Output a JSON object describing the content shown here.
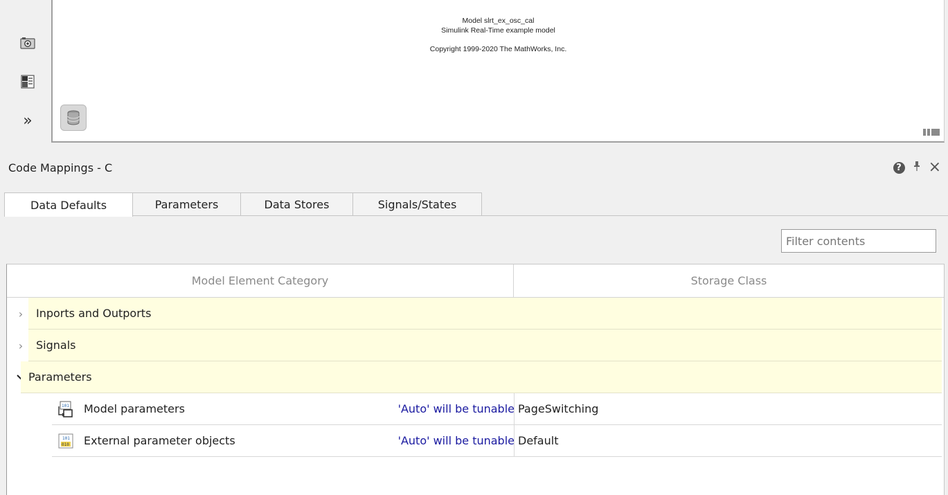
{
  "canvas": {
    "model_line": "Model slrt_ex_osc_cal",
    "subtitle_line": "Simulink Real-Time example model",
    "copyright_line": "Copyright 1999-2020 The MathWorks, Inc."
  },
  "left_toolbar": {
    "items": [
      {
        "icon": "camera-icon"
      },
      {
        "icon": "model-browser-icon"
      },
      {
        "icon": "expand-icon",
        "label": "»"
      }
    ]
  },
  "panel": {
    "title": "Code Mappings - C",
    "help_symbol": "?",
    "pin_symbol": "⫯",
    "close_symbol": "×"
  },
  "tabs": [
    {
      "label": "Data Defaults",
      "active": true
    },
    {
      "label": "Parameters",
      "active": false
    },
    {
      "label": "Data Stores",
      "active": false
    },
    {
      "label": "Signals/States",
      "active": false
    }
  ],
  "filter": {
    "placeholder": "Filter contents",
    "value": ""
  },
  "table": {
    "columns": [
      "Model Element Category",
      "Storage Class"
    ],
    "categories": [
      {
        "label": "Inports and Outports",
        "expanded": false
      },
      {
        "label": "Signals",
        "expanded": false
      },
      {
        "label": "Parameters",
        "expanded": true
      }
    ],
    "rows": [
      {
        "name": "Model parameters",
        "note": "'Auto' will be tunable",
        "storage_class": "PageSwitching",
        "icon": "model-parameter-icon"
      },
      {
        "name": "External parameter objects",
        "note": "'Auto' will be tunable",
        "storage_class": "Default",
        "icon": "external-parameter-icon"
      }
    ]
  },
  "colors": {
    "category_bg": "#fffee0",
    "note_text": "#1a1aa0",
    "header_text": "#8a8a8a"
  }
}
